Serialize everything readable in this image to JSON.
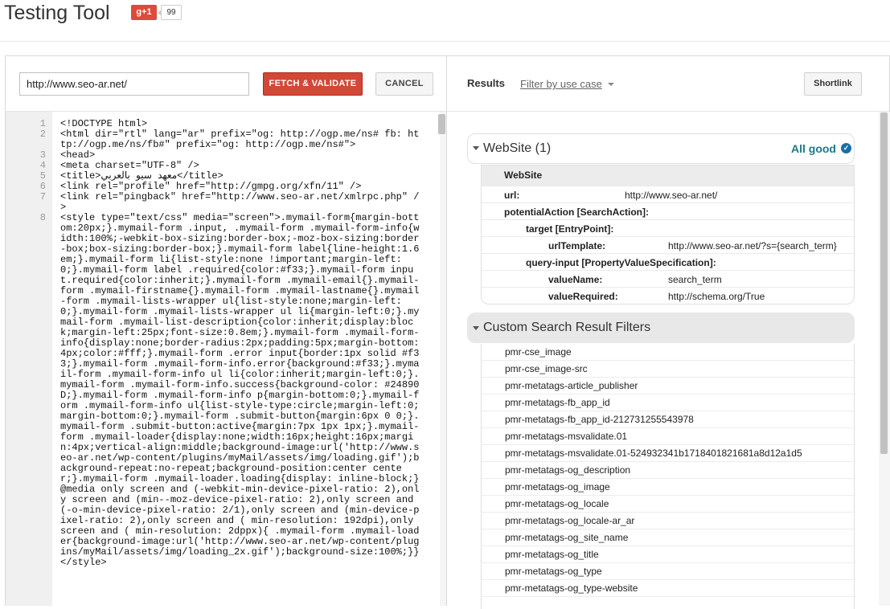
{
  "header": {
    "title": "Testing Tool",
    "gplus_label": "g+1",
    "gplus_count": "99"
  },
  "toolbar": {
    "url_value": "http://www.seo-ar.net/",
    "fetch_label": "FETCH & VALIDATE",
    "cancel_label": "CANCEL"
  },
  "results_toolbar": {
    "results_label": "Results",
    "dash": "-",
    "filter_label": "Filter by use case",
    "shortlink_label": "Shortlink"
  },
  "editor": {
    "lines": [
      {
        "n": "1",
        "text": "<!DOCTYPE html>"
      },
      {
        "n": "2",
        "text": "<html dir=\"rtl\" lang=\"ar\" prefix=\"og: http://ogp.me/ns# fb: http://ogp.me/ns/fb#\" prefix=\"og: http://ogp.me/ns#\">"
      },
      {
        "n": "3",
        "text": "<head>"
      },
      {
        "n": "4",
        "text": "<meta charset=\"UTF-8\" />"
      },
      {
        "n": "5",
        "text": "<title>معهد سيو بالعربي</title>"
      },
      {
        "n": "6",
        "text": "<link rel=\"profile\" href=\"http://gmpg.org/xfn/11\" />"
      },
      {
        "n": "7",
        "text": "<link rel=\"pingback\" href=\"http://www.seo-ar.net/xmlrpc.php\" />"
      },
      {
        "n": "8",
        "text": "<style type=\"text/css\" media=\"screen\">.mymail-form{margin-bottom:20px;}.mymail-form .input, .mymail-form .mymail-form-info{width:100%;-webkit-box-sizing:border-box;-moz-box-sizing:border-box;box-sizing:border-box;}.mymail-form label{line-height:1.6em;}.mymail-form li{list-style:none !important;margin-left:0;}.mymail-form label .required{color:#f33;}.mymail-form input.required{color:inherit;}.mymail-form .mymail-email{}.mymail-form .mymail-firstname{}.mymail-form .mymail-lastname{}.mymail-form .mymail-lists-wrapper ul{list-style:none;margin-left:0;}.mymail-form .mymail-lists-wrapper ul li{margin-left:0;}.mymail-form .mymail-list-description{color:inherit;display:block;margin-left:25px;font-size:0.8em;}.mymail-form .mymail-form-info{display:none;border-radius:2px;padding:5px;margin-bottom:4px;color:#fff;}.mymail-form .error input{border:1px solid #f33;}.mymail-form .mymail-form-info.error{background:#f33;}.mymail-form .mymail-form-info ul li{color:inherit;margin-left:0;}.mymail-form .mymail-form-info.success{background-color: #24890D;}.mymail-form .mymail-form-info p{margin-bottom:0;}.mymail-form .mymail-form-info ul{list-style-type:circle;margin-left:0;margin-bottom:0;}.mymail-form .submit-button{margin:6px 0 0;}.mymail-form .submit-button:active{margin:7px 1px 1px;}.mymail-form .mymail-loader{display:none;width:16px;height:16px;margin:4px;vertical-align:middle;background-image:url('http://www.seo-ar.net/wp-content/plugins/myMail/assets/img/loading.gif');background-repeat:no-repeat;background-position:center center;}.mymail-form .mymail-loader.loading{display: inline-block;}@media only screen and (-webkit-min-device-pixel-ratio: 2),only screen and (min--moz-device-pixel-ratio: 2),only screen and (-o-min-device-pixel-ratio: 2/1),only screen and (min-device-pixel-ratio: 2),only screen and ( min-resolution: 192dpi),only screen and ( min-resolution: 2dppx){ .mymail-form .mymail-loader{background-image:url('http://www.seo-ar.net/wp-content/plugins/myMail/assets/img/loading_2x.gif');background-size:100%;}}</style>"
      }
    ]
  },
  "website_section": {
    "title": "WebSite (1)",
    "status": "All good",
    "type_label": "WebSite",
    "url_key": "url:",
    "url_value": "http://www.seo-ar.net/",
    "potential_action_key": "potentialAction [SearchAction]:",
    "target_key": "target [EntryPoint]:",
    "url_template_key": "urlTemplate:",
    "url_template_value": "http://www.seo-ar.net/?s={search_term}",
    "query_input_key": "query-input [PropertyValueSpecification]:",
    "value_name_key": "valueName:",
    "value_name_value": "search_term",
    "value_required_key": "valueRequired:",
    "value_required_value": "http://schema.org/True"
  },
  "filters_section": {
    "title": "Custom Search Result Filters",
    "items": [
      "pmr-cse_image",
      "pmr-cse_image-src",
      "pmr-metatags-article_publisher",
      "pmr-metatags-fb_app_id",
      "pmr-metatags-fb_app_id-212731255543978",
      "pmr-metatags-msvalidate.01",
      "pmr-metatags-msvalidate.01-524932341b1718401821681a8d12a1d5",
      "pmr-metatags-og_description",
      "pmr-metatags-og_image",
      "pmr-metatags-og_locale",
      "pmr-metatags-og_locale-ar_ar",
      "pmr-metatags-og_site_name",
      "pmr-metatags-og_title",
      "pmr-metatags-og_type",
      "pmr-metatags-og_type-website"
    ]
  },
  "colors": {
    "fetch_button": "#d14836",
    "status_ok": "#1a7a8a",
    "check_icon": "#1a6fa5"
  }
}
